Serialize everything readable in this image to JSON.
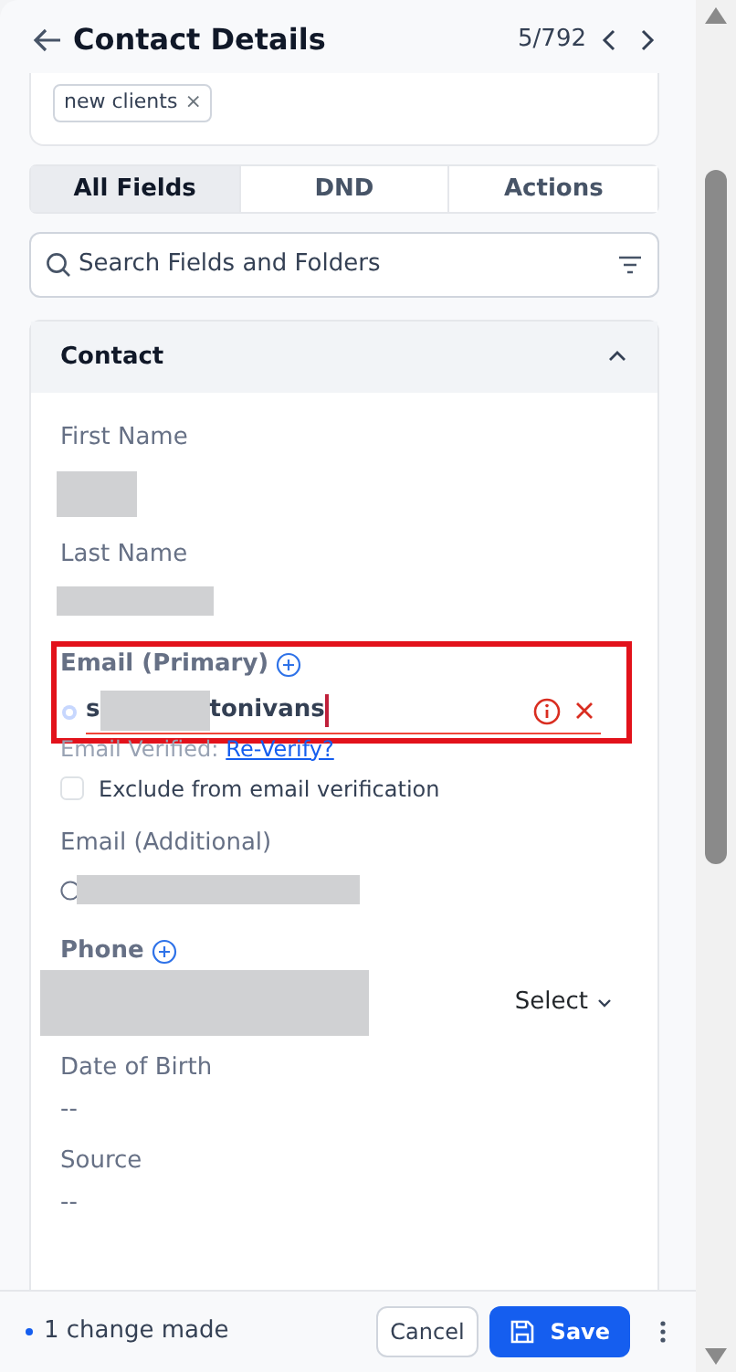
{
  "header": {
    "title": "Contact Details",
    "counter": "5/792"
  },
  "tags": [
    {
      "label": "new clients",
      "remove": "×"
    }
  ],
  "tabs": [
    {
      "label": "All Fields",
      "selected": true
    },
    {
      "label": "DND",
      "selected": false
    },
    {
      "label": "Actions",
      "selected": false
    }
  ],
  "search": {
    "placeholder": "Search Fields and Folders"
  },
  "section": {
    "title": "Contact",
    "expanded": true
  },
  "fields": [
    {
      "kind": "redacted_box",
      "label": "First Name"
    },
    {
      "kind": "redacted_bar",
      "label": "Last Name"
    },
    {
      "kind": "email",
      "label": "Email (Primary)",
      "prefix": "s",
      "suffix": "tonivans",
      "error": true,
      "highlighted": true,
      "verified_label": "Email Verified:",
      "verify_link": "Re-Verify?",
      "exclude_label": "Exclude from email verification",
      "exclude_checked": false
    },
    {
      "kind": "email_additional",
      "label": "Email (Additional)"
    },
    {
      "kind": "phone",
      "label": "Phone",
      "select": "Select"
    },
    {
      "kind": "text",
      "label": "Date of Birth",
      "value": "--"
    },
    {
      "kind": "text",
      "label": "Source",
      "value": "--"
    }
  ],
  "footer": {
    "status": "1 change made",
    "cancel": "Cancel",
    "save": "Save"
  }
}
